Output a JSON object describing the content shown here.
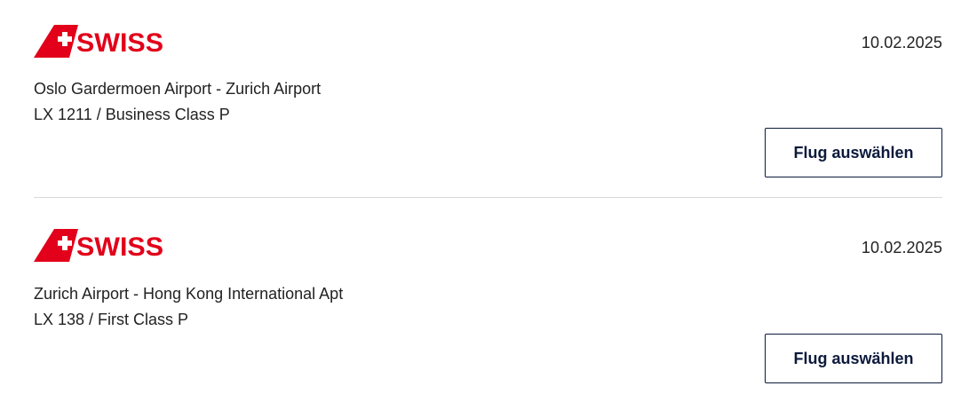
{
  "brand": {
    "logo_text": "SWISS",
    "color": "#e2001a"
  },
  "button_color": "#0c1a3c",
  "flights": [
    {
      "date": "10.02.2025",
      "route": "Oslo Gardermoen Airport - Zurich Airport",
      "flight_info": "LX 1211 / Business Class P",
      "select_label": "Flug auswählen"
    },
    {
      "date": "10.02.2025",
      "route": "Zurich Airport - Hong Kong International Apt",
      "flight_info": "LX 138 / First Class P",
      "select_label": "Flug auswählen"
    }
  ]
}
